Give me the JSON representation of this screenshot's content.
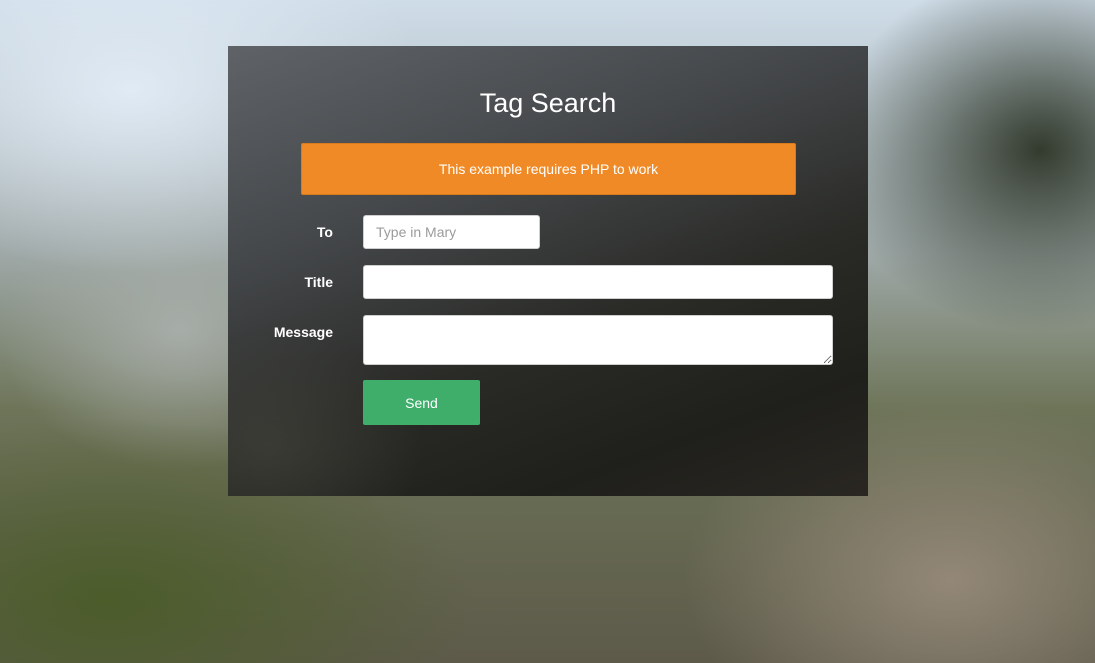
{
  "form": {
    "title": "Tag Search",
    "notice": "This example requires PHP to work",
    "to": {
      "label": "To",
      "value": "",
      "placeholder": "Type in Mary"
    },
    "title_field": {
      "label": "Title",
      "value": "",
      "placeholder": ""
    },
    "message": {
      "label": "Message",
      "value": "",
      "placeholder": ""
    },
    "send_label": "Send"
  },
  "colors": {
    "notice_bg": "#f08a26",
    "send_bg": "#3fae6b",
    "card_bg": "#3a3c3d"
  }
}
